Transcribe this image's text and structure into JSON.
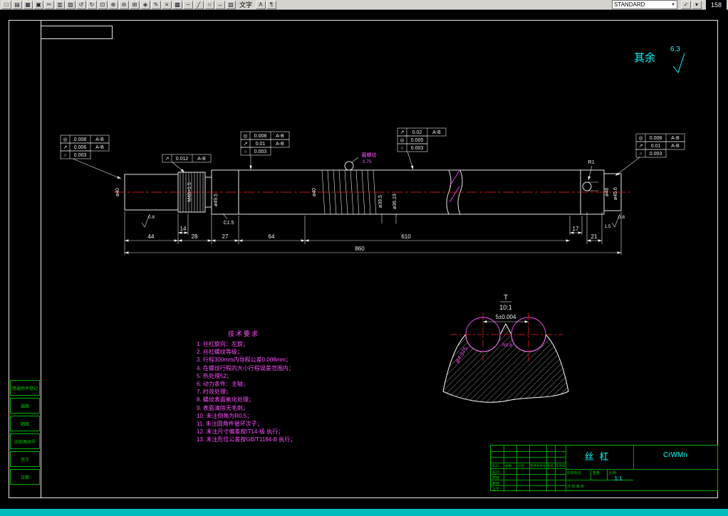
{
  "toolbar": {
    "icons_left": [
      {
        "name": "new-icon",
        "glyph": "□"
      },
      {
        "name": "open-icon",
        "glyph": "▤"
      },
      {
        "name": "save-icon",
        "glyph": "▦"
      },
      {
        "name": "print-icon",
        "glyph": "▣"
      },
      {
        "name": "cut-icon",
        "glyph": "✂"
      },
      {
        "name": "copy-icon",
        "glyph": "▥"
      },
      {
        "name": "paste-icon",
        "glyph": "▨"
      },
      {
        "name": "undo-icon",
        "glyph": "↺"
      },
      {
        "name": "redo-icon",
        "glyph": "↻"
      },
      {
        "name": "zoom-window-icon",
        "glyph": "⊡"
      },
      {
        "name": "zoom-in-icon",
        "glyph": "⊕"
      },
      {
        "name": "zoom-out-icon",
        "glyph": "⊖"
      },
      {
        "name": "zoom-extents-icon",
        "glyph": "⊞"
      },
      {
        "name": "pan-icon",
        "glyph": "◈"
      },
      {
        "name": "redraw-icon",
        "glyph": "✎"
      },
      {
        "name": "layers-icon",
        "glyph": "≡"
      },
      {
        "name": "color-icon",
        "glyph": "▩"
      },
      {
        "name": "linetype-icon",
        "glyph": "╌"
      },
      {
        "name": "line-icon",
        "glyph": "╱"
      },
      {
        "name": "circle-icon",
        "glyph": "○"
      },
      {
        "name": "dimension-icon",
        "glyph": "↔"
      },
      {
        "name": "table-icon",
        "glyph": "▧"
      }
    ],
    "text_tool_label": "文字",
    "icons_mid": [
      {
        "name": "text-style-icon",
        "glyph": "A"
      },
      {
        "name": "mtext-icon",
        "glyph": "¶"
      }
    ],
    "style_combo": "STANDARD",
    "combo_arrow": "▼",
    "icons_right": [
      {
        "name": "spell-icon",
        "glyph": "✓"
      },
      {
        "name": "options-icon",
        "glyph": "▾"
      }
    ],
    "page_indicator": "158"
  },
  "sheet": {
    "surface_note": {
      "prefix": "其余",
      "value": "6.3"
    },
    "frames": {
      "a": {
        "rows": [
          {
            "sym": "◎",
            "val": "0.008",
            "datum": "A-B"
          },
          {
            "sym": "↗",
            "val": "0.006",
            "datum": "A-B"
          },
          {
            "sym": "○",
            "val": "0.003",
            "datum": ""
          }
        ]
      },
      "b": {
        "rows": [
          {
            "sym": "↗",
            "val": "0.012",
            "datum": "A-B"
          }
        ]
      },
      "c": {
        "rows": [
          {
            "sym": "◎",
            "val": "0.008",
            "datum": "A-B"
          },
          {
            "sym": "↗",
            "val": "0.01",
            "datum": "A-B"
          },
          {
            "sym": "○",
            "val": "0.003",
            "datum": ""
          }
        ]
      },
      "d": {
        "rows": [
          {
            "sym": "↗",
            "val": "0.02",
            "datum": "A-B"
          },
          {
            "sym": "◎",
            "val": "0.005",
            "datum": ""
          },
          {
            "sym": "○",
            "val": "0.003",
            "datum": ""
          }
        ]
      },
      "e": {
        "rows": [
          {
            "sym": "◎",
            "val": "0.008",
            "datum": "A-B"
          },
          {
            "sym": "↗",
            "val": "0.01",
            "datum": "A-B"
          },
          {
            "sym": "○",
            "val": "0.003",
            "datum": ""
          }
        ]
      }
    },
    "dims": {
      "d44": "44",
      "d28": "28",
      "d14": "14",
      "d27": "27",
      "d64": "64",
      "d610": "610",
      "d860": "860",
      "d21": "21",
      "d17": "17",
      "d15": "1.5"
    },
    "dia_labels": [
      "ø40",
      "M48×1.5",
      "ø49.5",
      "ø40",
      "ø39.5",
      "ø36.19",
      "ø48",
      "ø45.6"
    ],
    "radius_note": "R1",
    "chamfer_note": "C1.5",
    "roughness_left": "0.8",
    "roughness_right": "0.8",
    "callout": {
      "line1": "磨螺纹",
      "line2": "3.75"
    },
    "detail": {
      "title": "T",
      "scale": "10:1",
      "dim": "5±0.004",
      "ball": "ø4.375",
      "radius": "R0.8"
    }
  },
  "tech_req": {
    "title": "技术要求",
    "items": [
      "1. 丝杠旋向：左旋；",
      "2. 丝杠螺纹等级；",
      "3. 行程300mm内导程公差0.008mm；",
      "4. 在螺纹行程的大小行程误差范围内；",
      "5. 热处理52；",
      "6. 动力条件：主轴；",
      "7. 时效处理；",
      "8. 螺纹表面氧化处理；",
      "9. 表面清除无毛刺；",
      "10. 未注倒角为R0.5；",
      "11. 未注圆角件循环次子；",
      "12. 未注尺寸偏差按IT14-级 执行；",
      "13. 未注形位公差按GB/T1184-B 执行；"
    ]
  },
  "side_boxes": [
    {
      "label": "借通用件登记"
    },
    {
      "label": "描图"
    },
    {
      "label": "晒图"
    },
    {
      "label": "旧底图总号"
    },
    {
      "label": "签字"
    },
    {
      "label": "日期"
    }
  ],
  "title_block": {
    "part_name": "丝杠",
    "material": "CrWMn",
    "scale_value": "1:1",
    "labels": {
      "mark": "标记",
      "count": "处数",
      "zone": "分区",
      "doc": "更改文件号",
      "sign": "签名",
      "date": "年月日",
      "design": "设计",
      "check": "校核",
      "review": "审核",
      "process": "工艺",
      "stage": "阶段标记",
      "weight": "重量",
      "scale": "比例",
      "sheets": "共 张 第 张"
    }
  }
}
